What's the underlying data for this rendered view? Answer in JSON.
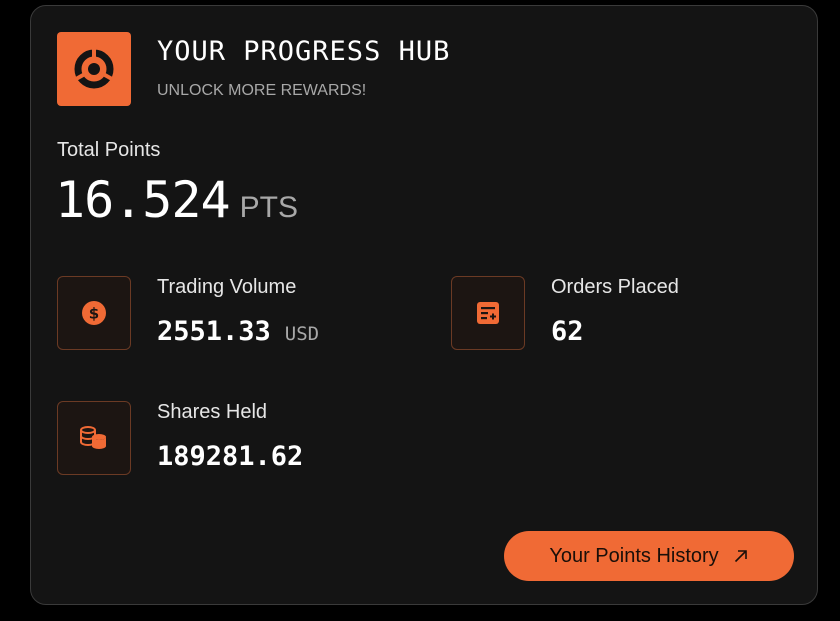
{
  "header": {
    "title": "YOUR PROGRESS HUB",
    "subtitle": "UNLOCK MORE REWARDS!",
    "logo_icon": "segmented-ring-logo-icon"
  },
  "total_points": {
    "label": "Total Points",
    "value": "16.524",
    "unit": "PTS"
  },
  "stats": [
    {
      "label": "Trading Volume",
      "value": "2551.33",
      "unit": "USD",
      "icon": "dollar-coin-icon"
    },
    {
      "label": "Orders Placed",
      "value": "62",
      "unit": "",
      "icon": "order-list-add-icon"
    },
    {
      "label": "Shares Held",
      "value": "189281.62",
      "unit": "",
      "icon": "coin-stack-icon"
    }
  ],
  "history_button": {
    "label": "Your Points History",
    "icon": "arrow-up-right-icon"
  },
  "colors": {
    "accent": "#f06a35",
    "card_background": "#141414",
    "page_background": "#000000",
    "muted_text": "#a8a8a8"
  }
}
